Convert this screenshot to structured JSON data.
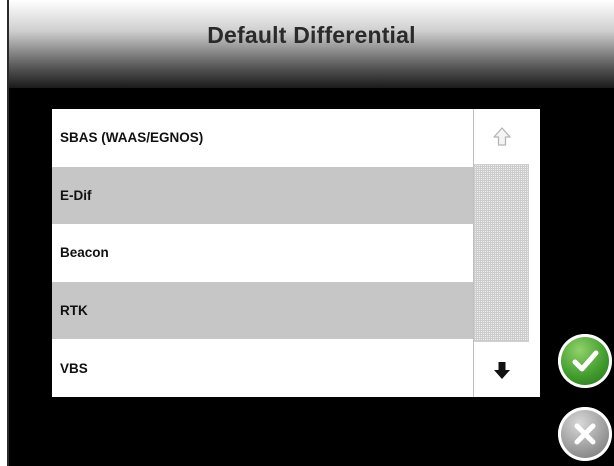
{
  "window": {
    "title": "Default Differential"
  },
  "list": {
    "items": [
      {
        "label": "SBAS (WAAS/EGNOS)"
      },
      {
        "label": "E-Dif"
      },
      {
        "label": "Beacon"
      },
      {
        "label": "RTK"
      },
      {
        "label": "VBS"
      }
    ]
  },
  "icons": {
    "scroll_up": "arrow-up-outline-icon",
    "scroll_down": "arrow-down-icon",
    "confirm": "checkmark-icon",
    "cancel": "x-icon"
  },
  "colors": {
    "background": "#000000",
    "row_alt": "#c6c6c6",
    "confirm_green": "#3f9a2b",
    "cancel_gray": "#9a9a9a"
  }
}
